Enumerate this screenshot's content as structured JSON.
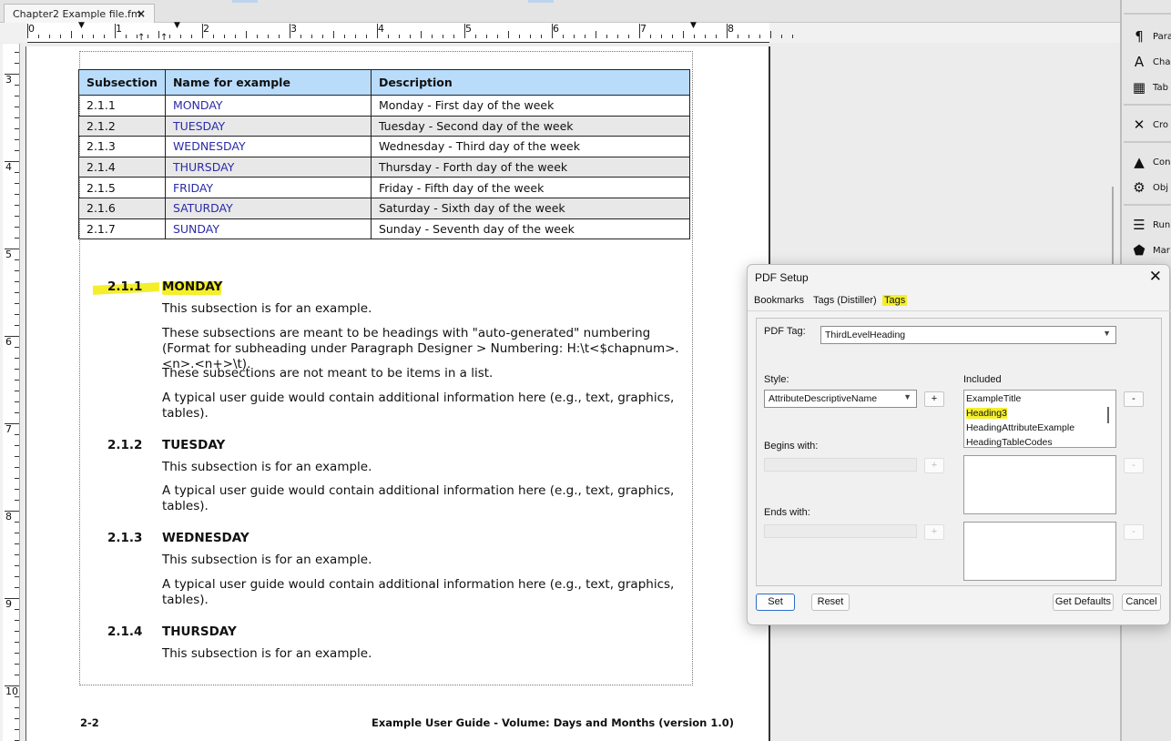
{
  "doc_tab": {
    "label": "Chapter2 Example file.fm",
    "close": "×"
  },
  "hruler": {
    "numbers": [
      "0",
      "1",
      "2",
      "3",
      "4",
      "5",
      "6",
      "7",
      "8"
    ]
  },
  "vruler": {
    "numbers": [
      "3",
      "4",
      "5",
      "6",
      "7",
      "8",
      "9",
      "10"
    ]
  },
  "table": {
    "headers": [
      "Subsection",
      "Name for example",
      "Description"
    ],
    "rows": [
      [
        "2.1.1",
        "MONDAY",
        "Monday - First day of the week"
      ],
      [
        "2.1.2",
        "TUESDAY",
        "Tuesday - Second day of the week"
      ],
      [
        "2.1.3",
        "WEDNESDAY",
        "Wednesday - Third day of the week"
      ],
      [
        "2.1.4",
        "THURSDAY",
        "Thursday - Forth day of the week"
      ],
      [
        "2.1.5",
        "FRIDAY",
        "Friday - Fifth day of the week"
      ],
      [
        "2.1.6",
        "SATURDAY",
        "Saturday - Sixth day of the week"
      ],
      [
        "2.1.7",
        "SUNDAY",
        "Sunday - Seventh day of the week"
      ]
    ]
  },
  "sections": [
    {
      "num": "2.1.1",
      "title": "MONDAY",
      "paras": [
        "This subsection is for an example.",
        "These subsections are meant to be headings with \"auto-generated\" numbering (Format for subheading under Paragraph Designer > Numbering: H:\\t<$chapnum>.<n>.<n+>\\t).",
        "These subsections are not meant to be items in a list.",
        "A typical user guide would contain additional information here (e.g., text, graphics, tables)."
      ]
    },
    {
      "num": "2.1.2",
      "title": "TUESDAY",
      "paras": [
        "This subsection is for an example.",
        "A typical user guide would contain additional information here (e.g., text, graphics, tables)."
      ]
    },
    {
      "num": "2.1.3",
      "title": "WEDNESDAY",
      "paras": [
        "This subsection is for an example.",
        "A typical user guide would contain additional information here (e.g., text, graphics, tables)."
      ]
    },
    {
      "num": "2.1.4",
      "title": "THURSDAY",
      "paras": [
        "This subsection is for an example."
      ]
    }
  ],
  "footer": {
    "left": "2-2",
    "right": "Example User Guide - Volume: Days and Months (version 1.0)"
  },
  "right_panel": [
    "Para",
    "Cha",
    "Tab",
    "Cro",
    "Con",
    "Obj",
    "Run",
    "Mar"
  ],
  "dialog": {
    "title": "PDF Setup",
    "close": "✕",
    "tabs": [
      "Bookmarks",
      "Tags (Distiller)",
      "Tags"
    ],
    "active_tab": "Tags",
    "pdf_tag_label": "PDF Tag:",
    "pdf_tag_value": "ThirdLevelHeading",
    "style_label": "Style:",
    "style_value": "AttributeDescriptiveName",
    "included_label": "Included",
    "included_items": [
      "ExampleTitle",
      "Heading3",
      "HeadingAttributeExample",
      "HeadingTableCodes"
    ],
    "included_selected": "Heading3",
    "begins_label": "Begins with:",
    "ends_label": "Ends with:",
    "plus": "+",
    "minus": "-",
    "buttons": {
      "set": "Set",
      "reset": "Reset",
      "get_defaults": "Get Defaults",
      "cancel": "Cancel"
    }
  },
  "colors": {
    "table_header": "#b9dcfb",
    "day_name": "#2b2ba8",
    "highlight": "#f4ef2a"
  }
}
